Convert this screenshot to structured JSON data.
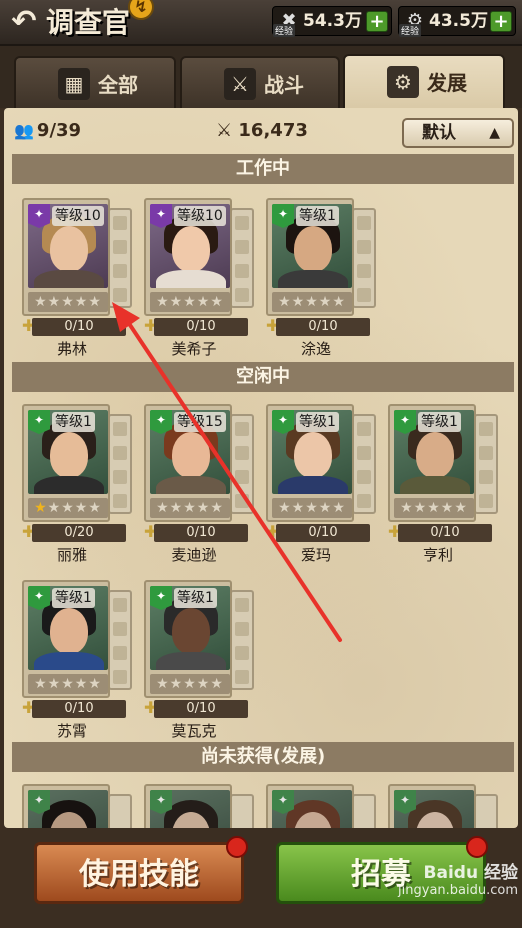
{
  "header": {
    "title": "调查官",
    "badge": "↯",
    "resources": [
      {
        "icon": "exp-icon",
        "tag": "经验",
        "value": "54.3万"
      },
      {
        "icon": "exp-icon",
        "tag": "经验",
        "value": "43.5万"
      }
    ],
    "plus": "+"
  },
  "tabs": [
    {
      "label": "全部",
      "icon": "grid-icon",
      "glyph": "▦"
    },
    {
      "label": "战斗",
      "icon": "crossed-swords-icon",
      "glyph": "⚔"
    },
    {
      "label": "发展",
      "icon": "tools-icon",
      "glyph": "⚙"
    }
  ],
  "stats": {
    "count": "9/39",
    "power": "16,473",
    "sort_label": "默认",
    "sort_chevron": "▲"
  },
  "sections": {
    "working": "工作中",
    "idle": "空闲中",
    "locked": "尚未获得(发展)"
  },
  "officers_working": [
    {
      "name": "弗林",
      "level": "等级10",
      "xp": "0/10",
      "stars": 0,
      "badge": "purple"
    },
    {
      "name": "美希子",
      "level": "等级10",
      "xp": "0/10",
      "stars": 0,
      "badge": "purple"
    },
    {
      "name": "涂逸",
      "level": "等级1",
      "xp": "0/10",
      "stars": 0,
      "badge": "green"
    }
  ],
  "officers_idle": [
    {
      "name": "丽雅",
      "level": "等级1",
      "xp": "0/20",
      "stars": 1,
      "badge": "green"
    },
    {
      "name": "麦迪逊",
      "level": "等级15",
      "xp": "0/10",
      "stars": 0,
      "badge": "green"
    },
    {
      "name": "爱玛",
      "level": "等级1",
      "xp": "0/10",
      "stars": 0,
      "badge": "green"
    },
    {
      "name": "亨利",
      "level": "等级1",
      "xp": "0/10",
      "stars": 0,
      "badge": "green"
    },
    {
      "name": "苏霄",
      "level": "等级1",
      "xp": "0/10",
      "stars": 0,
      "badge": "green"
    },
    {
      "name": "莫瓦克",
      "level": "等级1",
      "xp": "0/10",
      "stars": 0,
      "badge": "green"
    }
  ],
  "buttons": {
    "use_skill": "使用技能",
    "recruit": "招募"
  },
  "watermark": {
    "logo": "Baidu 经验",
    "url": "jingyan.baidu.com"
  },
  "colors": {
    "accent_green": "#4d9a2a",
    "accent_orange": "#c8703a",
    "badge_purple": "#7a3aa8",
    "badge_green": "#2f9a3e",
    "annotation_red": "#e8322a"
  }
}
